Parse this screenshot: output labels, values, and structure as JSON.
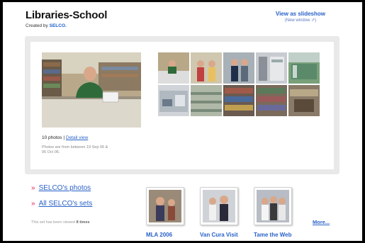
{
  "header": {
    "title": "Libraries-School",
    "created_prefix": "Created by",
    "creator": "SELCO.",
    "slideshow_label": "View as slideshow",
    "new_window_label": "(New window ⇗)"
  },
  "summary": {
    "photo_count": "10 photos",
    "separator": " | ",
    "detail_view": "Detail view",
    "dates_text": "Photos are from between 19 Sep 06 & 06 Oct 06."
  },
  "links": [
    {
      "label": "SELCO's photos"
    },
    {
      "label": "All SELCO's sets"
    }
  ],
  "views_prefix": "This set has been viewed",
  "views_count": "8 times",
  "sets": [
    {
      "title": "MLA 2006"
    },
    {
      "title": "Van Cura Visit"
    },
    {
      "title": "Tame the Web"
    }
  ],
  "more_label": "More...",
  "colors": {
    "link": "#2a62c8",
    "bullet": "#e0245e",
    "panel": "#e9e9e9"
  }
}
